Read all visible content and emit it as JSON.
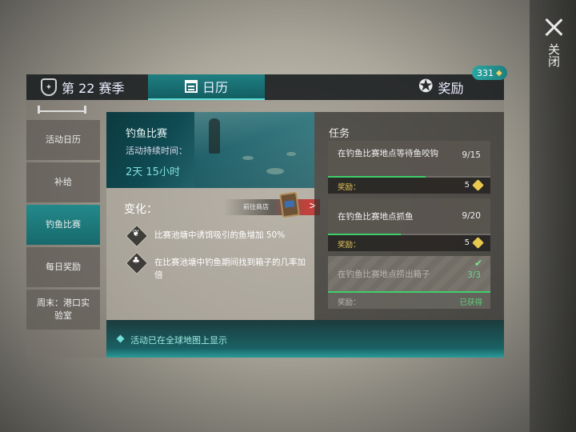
{
  "close": {
    "label": "关闭"
  },
  "tabs": {
    "season": {
      "label": "第 22 赛季"
    },
    "calendar": {
      "label": "日历"
    },
    "rewards": {
      "label": "奖励",
      "badge_count": "331"
    }
  },
  "sidebar": {
    "items": [
      {
        "label": "活动日历"
      },
      {
        "label": "补给"
      },
      {
        "label": "钓鱼比赛",
        "active": true
      },
      {
        "label": "每日奖励"
      },
      {
        "label": "周末：港口实验室"
      }
    ]
  },
  "event": {
    "title": "钓鱼比赛",
    "duration_label": "活动持续时间：",
    "duration": "2天 15小时"
  },
  "changes": {
    "title": "变化：",
    "store_button": "前往商店",
    "items": [
      {
        "text": "比赛池塘中诱饵吸引的鱼增加 50%",
        "icon": "bait-icon"
      },
      {
        "text": "在比赛池塘中钓鱼期间找到箱子的几率加倍",
        "icon": "clover-icon"
      }
    ]
  },
  "tasks": {
    "title": "任务",
    "items": [
      {
        "name": "在钓鱼比赛地点等待鱼咬钩",
        "progress": "9/15",
        "fraction": 0.6,
        "reward_label": "奖励：",
        "reward": "5",
        "done": false
      },
      {
        "name": "在钓鱼比赛地点抓鱼",
        "progress": "9/20",
        "fraction": 0.45,
        "reward_label": "奖励：",
        "reward": "5",
        "done": false
      },
      {
        "name": "在钓鱼比赛地点捞出箱子",
        "progress": "3/3",
        "fraction": 1.0,
        "reward_label": "奖励：",
        "status": "已获得",
        "done": true
      }
    ]
  },
  "footer": {
    "text": "活动已在全球地图上显示"
  },
  "colors": {
    "accent": "#1f7f82",
    "highlight": "#74e0da",
    "reward": "#e6c75a",
    "complete": "#5fd07a",
    "store": "#c2413c"
  }
}
